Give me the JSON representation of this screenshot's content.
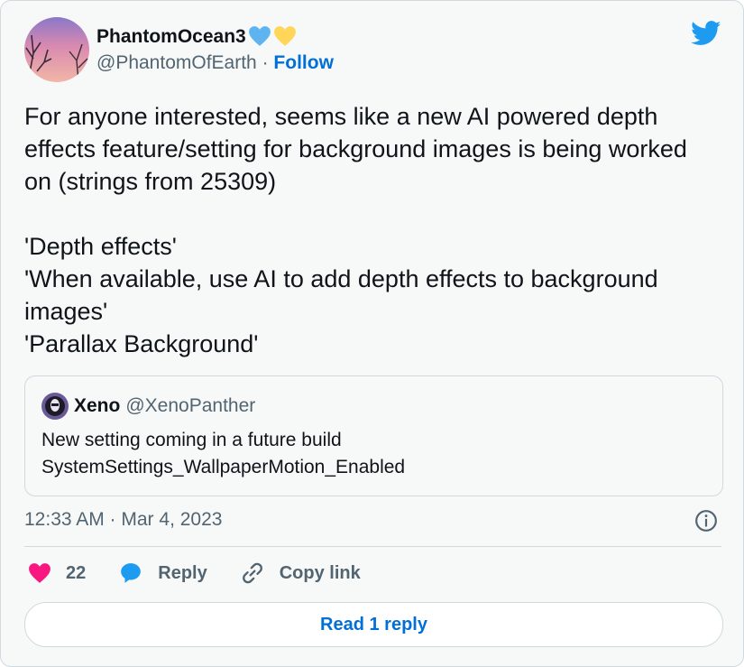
{
  "author": {
    "display_name": "PhantomOcean3",
    "handle": "@PhantomOfEarth",
    "separator": "·",
    "follow_label": "Follow"
  },
  "tweet": {
    "text": "For anyone interested, seems like a new AI powered depth effects feature/setting for background images is being worked on (strings from 25309)\n\n'Depth effects'\n'When available, use AI to add depth effects to background images'\n'Parallax Background'"
  },
  "quote": {
    "display_name": "Xeno",
    "handle": "@XenoPanther",
    "text": "New setting coming in a future build\nSystemSettings_WallpaperMotion_Enabled"
  },
  "meta": {
    "timestamp": "12:33 AM · Mar 4, 2023"
  },
  "actions": {
    "like_count": "22",
    "reply_label": "Reply",
    "copy_link_label": "Copy link",
    "read_replies_label": "Read 1 reply"
  },
  "colors": {
    "accent": "#006fd6",
    "like": "#f91880",
    "twitter_blue": "#1d9bf0",
    "heart_blue": "#5eb4f0",
    "heart_yellow": "#ffd55a"
  },
  "icons": [
    "blue-heart-icon",
    "yellow-heart-icon",
    "twitter-bird-icon",
    "info-icon",
    "like-heart-icon",
    "reply-bubble-icon",
    "link-icon"
  ]
}
